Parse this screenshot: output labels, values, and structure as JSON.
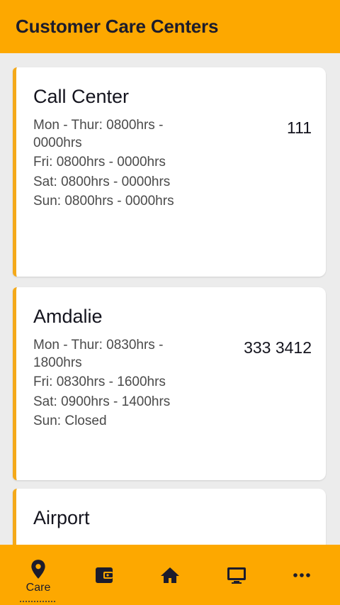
{
  "header": {
    "title": "Customer Care Centers"
  },
  "centers": [
    {
      "name": "Call Center",
      "phone": "111",
      "hours": [
        "Mon - Thur: 0800hrs - 0000hrs",
        "Fri: 0800hrs - 0000hrs",
        "Sat: 0800hrs - 0000hrs",
        "Sun: 0800hrs - 0000hrs"
      ]
    },
    {
      "name": "Amdalie",
      "phone": "333 3412",
      "hours": [
        "Mon - Thur: 0830hrs - 1800hrs",
        "Fri: 0830hrs - 1600hrs",
        "Sat: 0900hrs - 1400hrs",
        "Sun: Closed"
      ]
    },
    {
      "name": "Airport"
    }
  ],
  "bottom_nav": {
    "items": [
      {
        "icon": "location-pin-icon",
        "label": "Care",
        "active": true
      },
      {
        "icon": "wallet-icon"
      },
      {
        "icon": "home-icon"
      },
      {
        "icon": "monitor-icon"
      },
      {
        "icon": "more-dots-icon"
      }
    ]
  },
  "colors": {
    "accent": "#fda800",
    "card_border": "#f4a91a",
    "text_dark": "#1c1c2c"
  }
}
